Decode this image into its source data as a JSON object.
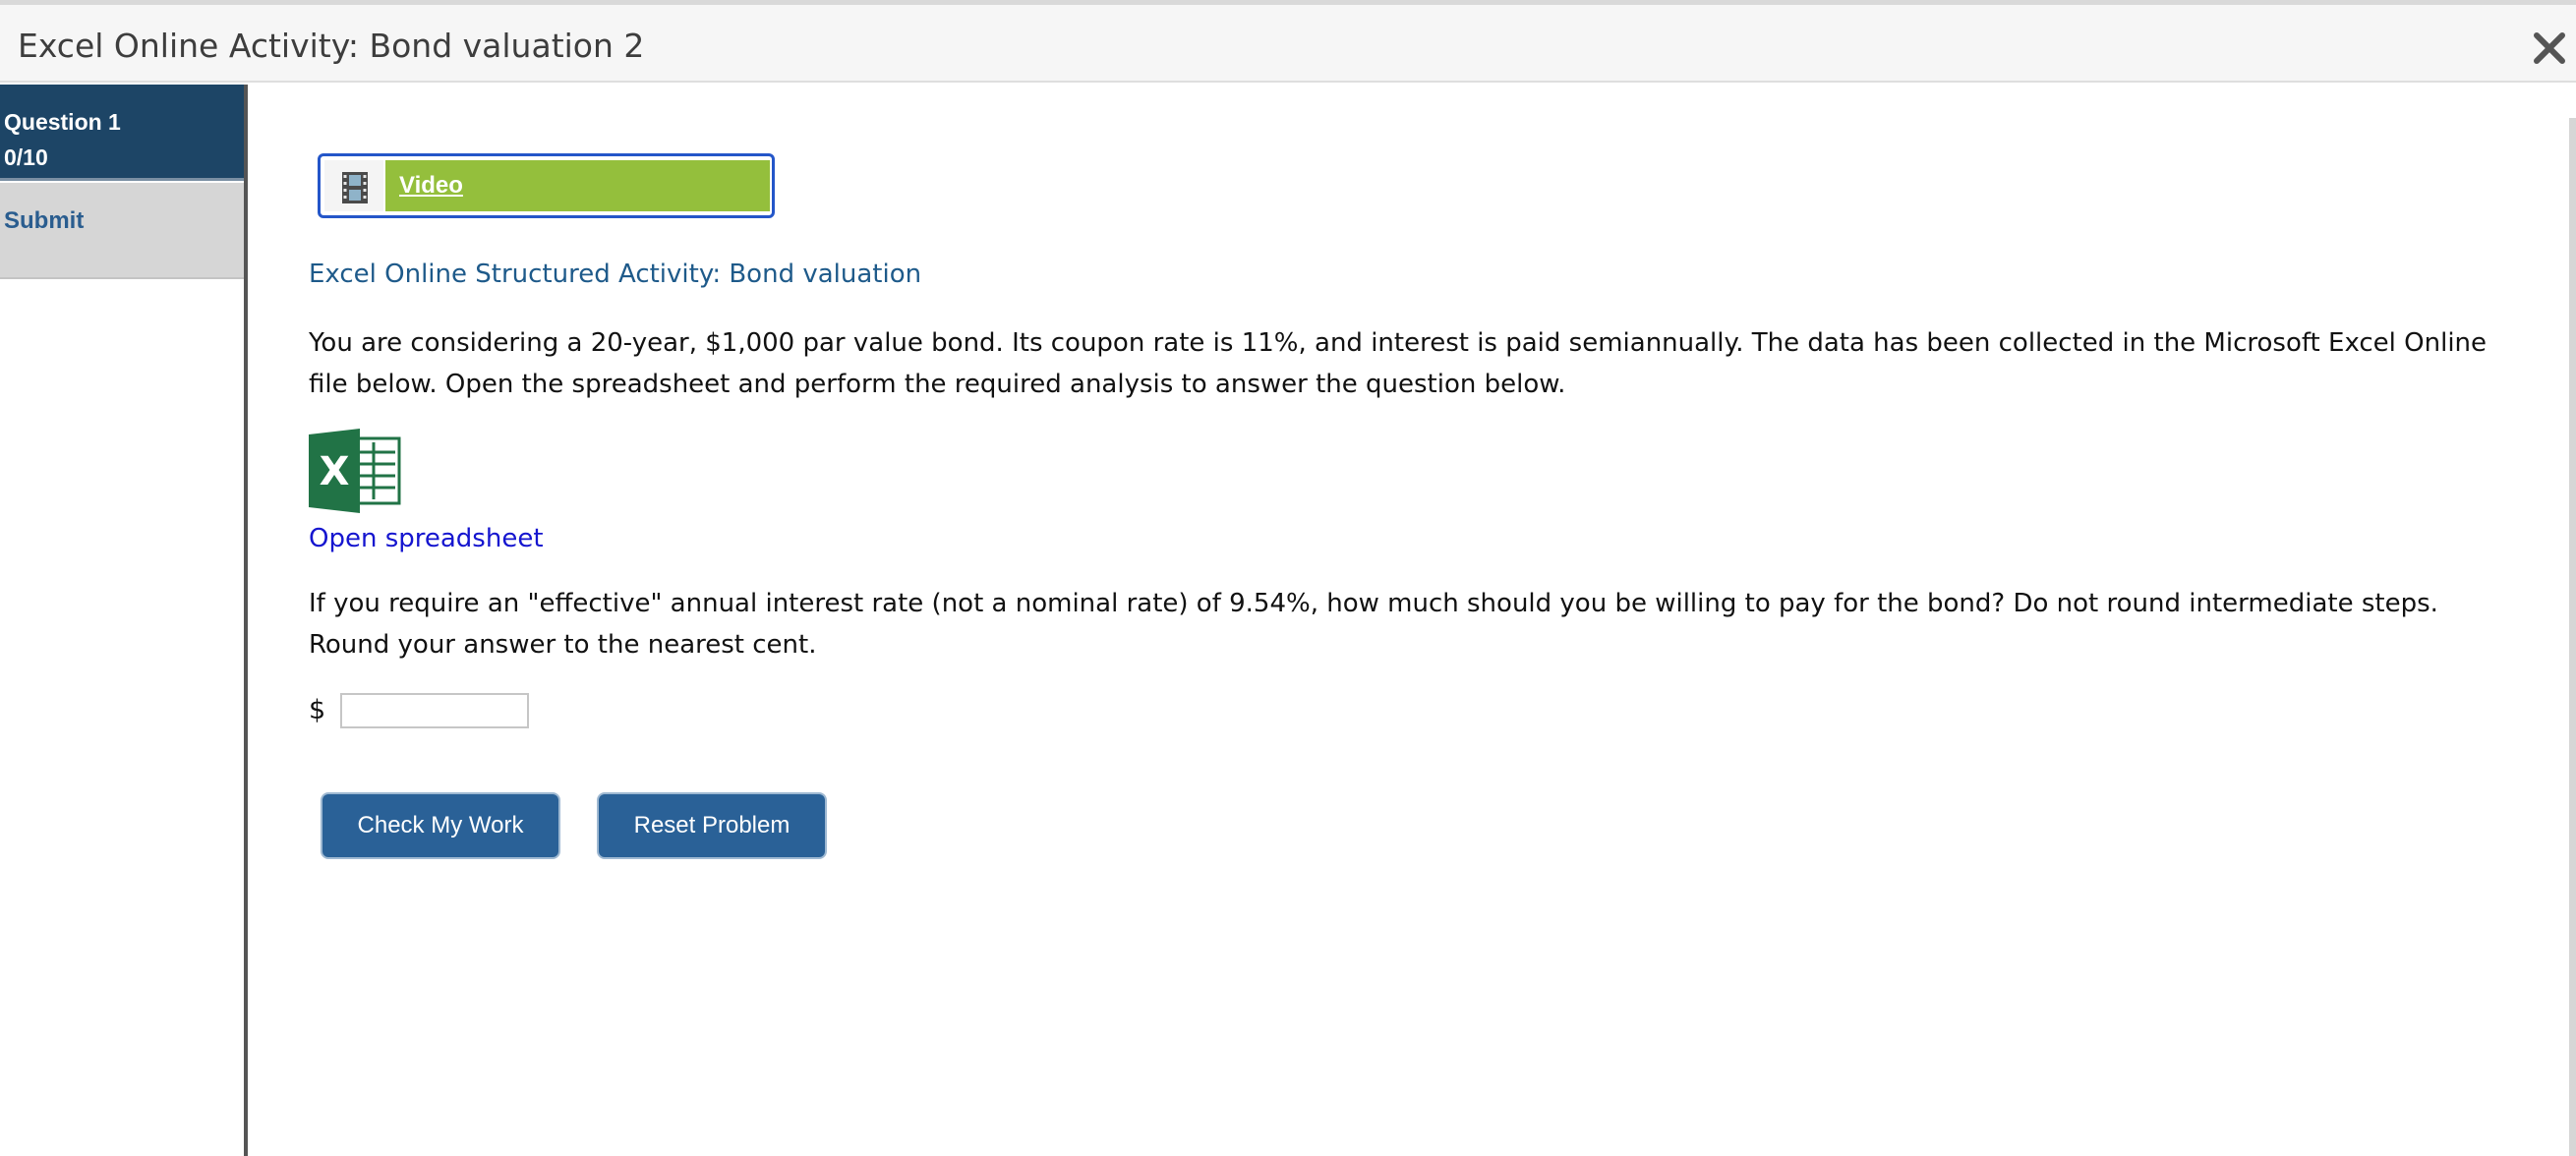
{
  "window": {
    "title": "Excel Online Activity: Bond valuation 2",
    "close_icon": "close-icon"
  },
  "sidebar": {
    "question_label": "Question 1",
    "question_score": "0/10",
    "submit_label": "Submit",
    "colors": {
      "active_bg": "#1d4566",
      "submit_bg": "#d6d6d6",
      "submit_text": "#2a5d8f"
    }
  },
  "main": {
    "video": {
      "label": "Video",
      "icon": "film-icon",
      "accent": "#94bf3c",
      "border": "#2456c9"
    },
    "activity_heading": "Excel Online Structured Activity: Bond valuation",
    "problem_text": "You are considering a 20-year, $1,000 par value bond. Its coupon rate is 11%, and interest is paid semiannually. The data has been collected in the Microsoft Excel Online file below. Open the spreadsheet and perform the required analysis to answer the question below.",
    "spreadsheet": {
      "icon": "excel-icon",
      "link_label": "Open spreadsheet",
      "icon_color": "#217346"
    },
    "question_text": "If you require an \"effective\" annual interest rate (not a nominal rate) of 9.54%, how much should you be willing to pay for the bond? Do not round intermediate steps. Round your answer to the nearest cent.",
    "answer": {
      "prefix": "$",
      "value": "",
      "placeholder": ""
    },
    "buttons": {
      "check_label": "Check My Work",
      "reset_label": "Reset Problem",
      "color": "#2a6197"
    }
  }
}
